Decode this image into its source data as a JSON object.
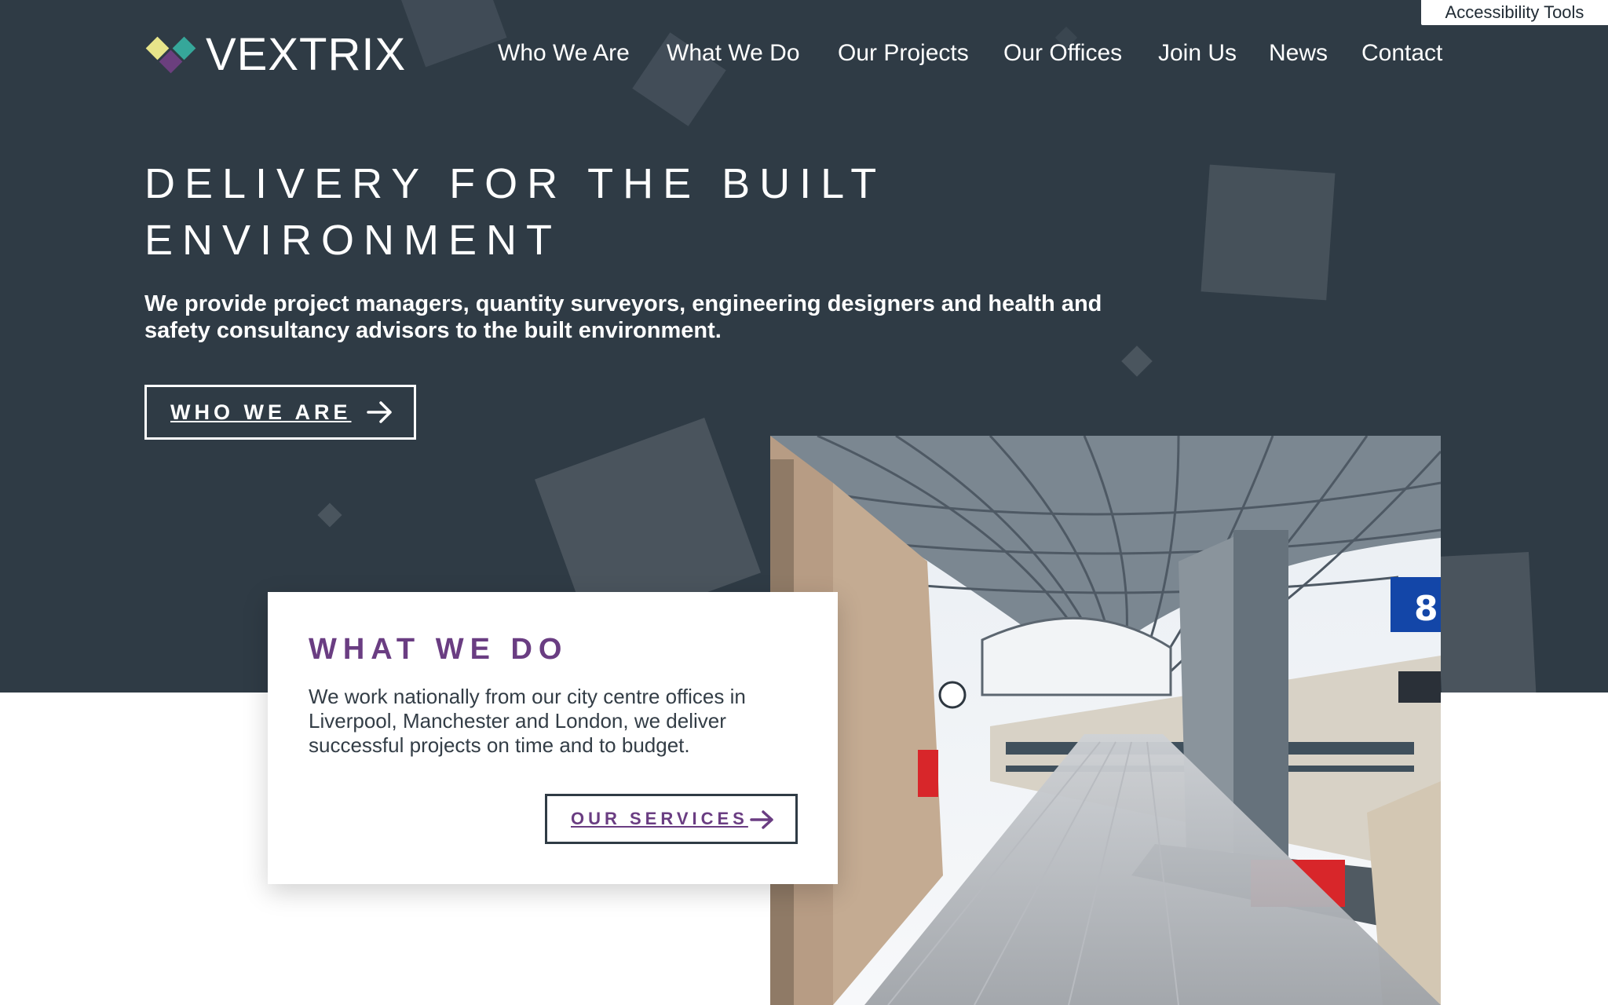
{
  "accessibility_label": "Accessibility Tools",
  "brand": {
    "name": "VEXTRIX",
    "colors": {
      "yellow": "#e7e58a",
      "teal": "#36a79a",
      "purple": "#6b3f7e"
    }
  },
  "nav": {
    "items": [
      {
        "label": "Who We Are"
      },
      {
        "label": "What We Do"
      },
      {
        "label": "Our Projects"
      },
      {
        "label": "Our Offices"
      },
      {
        "label": "Join Us"
      },
      {
        "label": "News"
      },
      {
        "label": "Contact"
      }
    ]
  },
  "hero": {
    "title": "Delivery for the built environment",
    "subtitle": "We provide project managers, quantity surveyors, engineering designers and health and safety consultancy advisors to the built environment.",
    "cta_label": "WHO WE ARE",
    "background": "#2f3b45"
  },
  "card": {
    "title": "WHAT WE DO",
    "text": "We work nationally from our city centre offices in Liverpool, Manchester and London, we deliver successful projects on time and to budget.",
    "cta_label": "OUR SERVICES",
    "accent": "#6a3d82"
  },
  "photo": {
    "icon": "railway-station-photo",
    "platform_number": "8"
  }
}
